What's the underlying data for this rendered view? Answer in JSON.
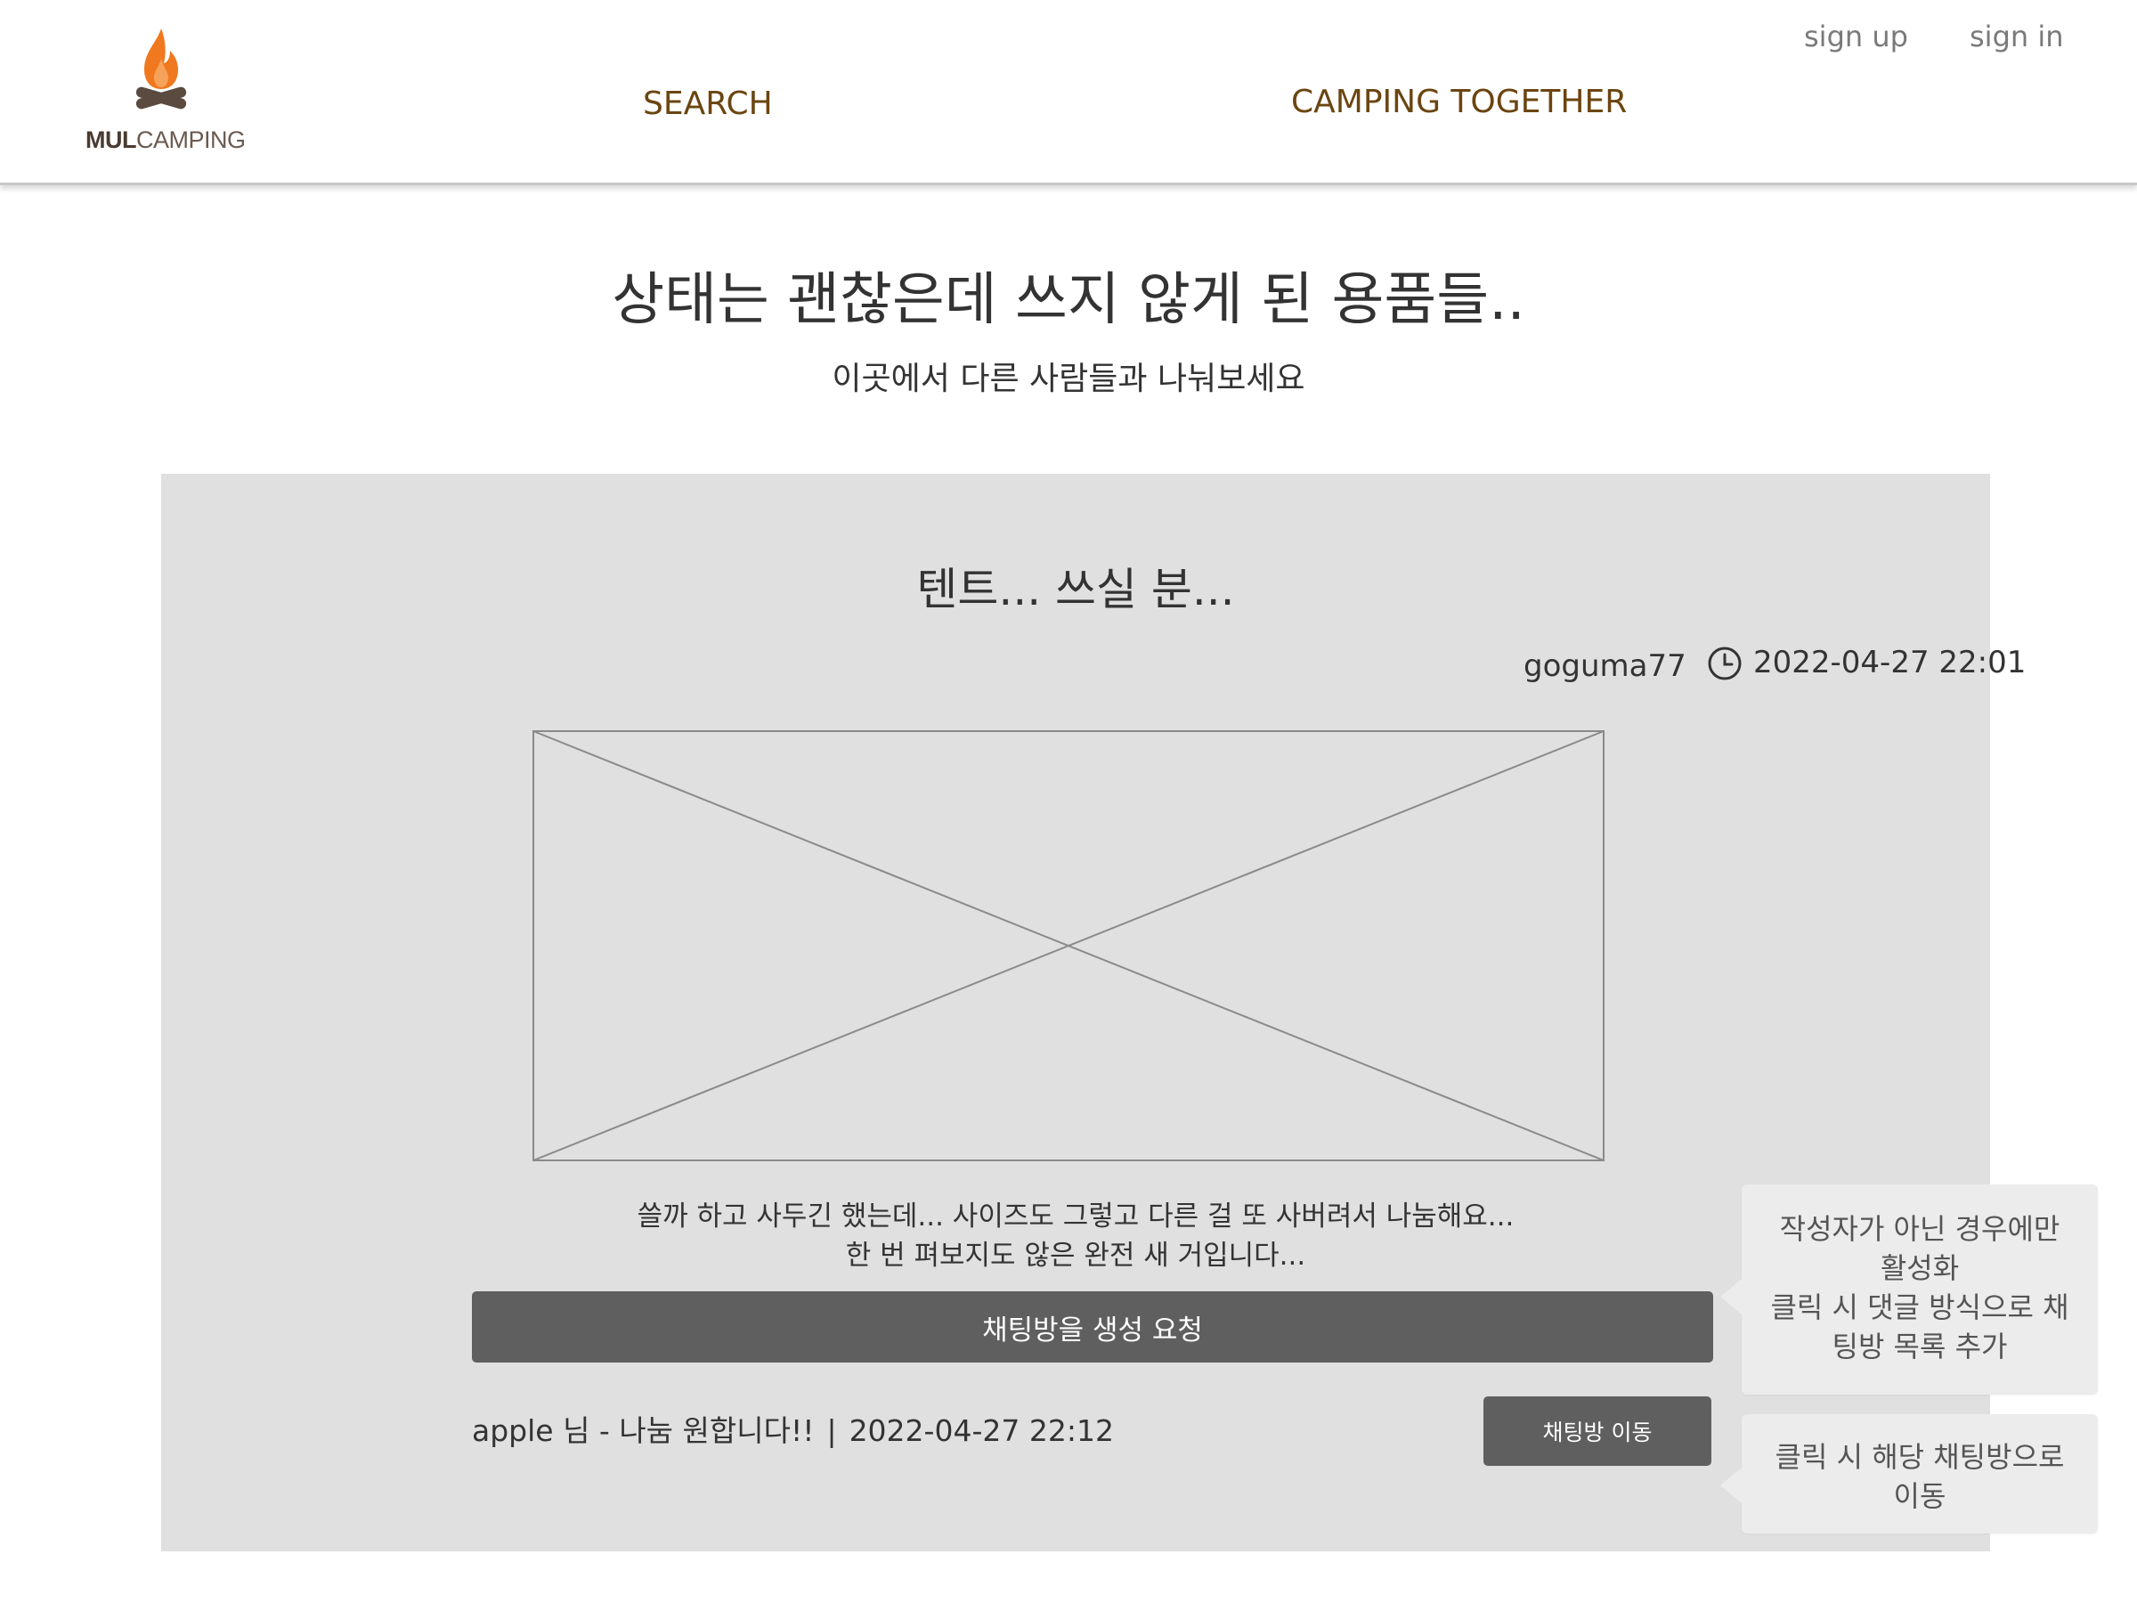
{
  "header": {
    "logo": {
      "text_bold": "MUL",
      "text_regular": "CAMPING",
      "icon": "campfire-icon",
      "flame_color": "#f0781e",
      "wood_color": "#5b4a3f"
    },
    "nav": {
      "search_label": "SEARCH",
      "camping_together_label": "CAMPING TOGETHER"
    },
    "auth": {
      "signup_label": "sign up",
      "signin_label": "sign in"
    }
  },
  "hero": {
    "title": "상태는 괜찮은데 쓰지 않게 된 용품들..",
    "subtitle": "이곳에서 다른 사람들과 나눠보세요"
  },
  "post": {
    "title": "텐트... 쓰실 분...",
    "author": "goguma77",
    "date_icon": "clock-icon",
    "date": "2022-04-27 22:01",
    "image": "image-placeholder",
    "body_line1": "쓸까 하고 사두긴 했는데... 사이즈도 그렇고 다른 걸 또 사버려서 나눔해요...",
    "body_line2": "한 번 펴보지도 않은 완전 새 거입니다...",
    "request_button_label": "채팅방을 생성 요청",
    "comment": {
      "text": "apple 님 - 나눔 원합니다!!",
      "separator": "|",
      "date": "2022-04-27 22:12",
      "move_button_label": "채팅방 이동"
    }
  },
  "notes": {
    "note1_line1": "작성자가 아닌 경우에만",
    "note1_line2": "활성화",
    "note1_line3": "클릭 시 댓글 방식으로 채",
    "note1_line4": "팅방 목록 추가",
    "note2_line1": "클릭 시 해당 채팅방으로",
    "note2_line2": "이동"
  },
  "colors": {
    "panel_background": "#e0e0e0",
    "button_background": "#5f5f5f",
    "nav_text": "#6b4510",
    "note_background": "#ececec"
  }
}
